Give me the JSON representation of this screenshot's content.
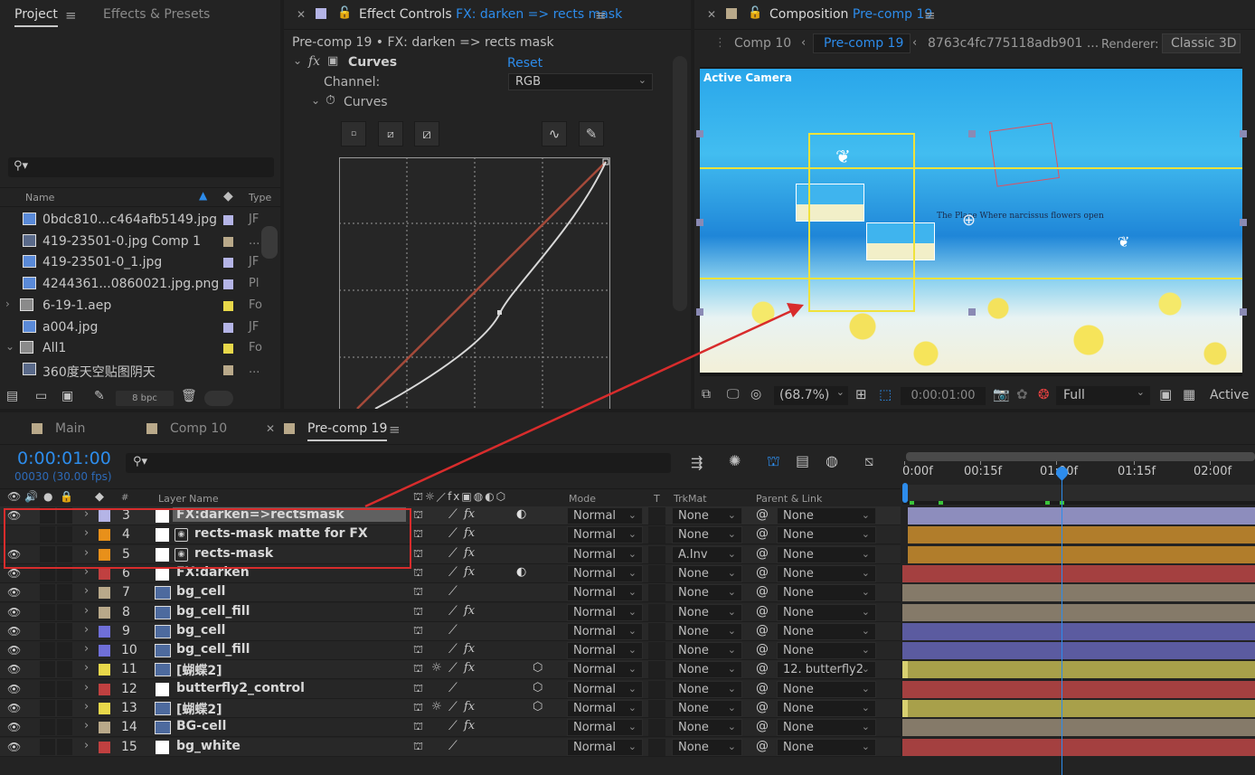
{
  "project": {
    "tabs": [
      "Project",
      "Effects & Presets"
    ],
    "search_placeholder": "",
    "col_name": "Name",
    "col_type": "Type",
    "items": [
      {
        "name": "0bdc810...c464afb5149.jpg",
        "type": "JF",
        "color": "#b4b4e6",
        "icon": "image-file-icon",
        "expand": ""
      },
      {
        "name": "419-23501-0.jpg Comp 1",
        "type": "...",
        "color": "#b9a98a",
        "icon": "composition-icon",
        "expand": ""
      },
      {
        "name": "419-23501-0_1.jpg",
        "type": "JF",
        "color": "#b4b4e6",
        "icon": "image-file-icon",
        "expand": ""
      },
      {
        "name": "4244361...0860021.jpg.png",
        "type": "Pl",
        "color": "#b4b4e6",
        "icon": "image-file-icon",
        "expand": ""
      },
      {
        "name": "6-19-1.aep",
        "type": "Fo",
        "color": "#e8d84a",
        "icon": "folder-icon",
        "expand": "›"
      },
      {
        "name": "a004.jpg",
        "type": "JF",
        "color": "#b4b4e6",
        "icon": "image-file-icon",
        "expand": ""
      },
      {
        "name": "All1",
        "type": "Fo",
        "color": "#e8d84a",
        "icon": "folder-icon",
        "expand": "⌄"
      },
      {
        "name": "360度天空贴图阴天",
        "type": "...",
        "color": "#b9a98a",
        "icon": "composition-icon",
        "expand": ""
      }
    ],
    "bpc": "8 bpc"
  },
  "effect_controls": {
    "tab_prefix": "Effect Controls",
    "tab_layer": "FX: darken => rects mask",
    "breadcrumb": "Pre-comp 19 • FX: darken => rects mask",
    "fx_label": "fx",
    "effect_name": "Curves",
    "reset": "Reset",
    "channel_label": "Channel:",
    "channel_value": "RGB",
    "curves_label": "Curves"
  },
  "composition": {
    "tab_prefix": "Composition",
    "tab_comp": "Pre-comp 19",
    "breadcrumbs": [
      "Comp 10",
      "Pre-comp 19",
      "8763c4fc775118adb901 ..."
    ],
    "renderer_label": "Renderer:",
    "renderer_value": "Classic 3D",
    "viewer_label": "Active Camera",
    "viewer_text": "The Place Where narcissus flowers open",
    "zoom": "(68.7%)",
    "timecode": "0:00:01:00",
    "resolution": "Full",
    "view": "Active"
  },
  "timeline": {
    "tabs": [
      {
        "label": "Main",
        "color": "#b9a98a"
      },
      {
        "label": "Comp 10",
        "color": "#b9a98a"
      },
      {
        "label": "Pre-comp 19",
        "color": "#b9a98a"
      }
    ],
    "timecode": "0:00:01:00",
    "frames": "00030 (30.00 fps)",
    "search_placeholder": "",
    "headers": {
      "num": "#",
      "layer_name": "Layer Name",
      "mode": "Mode",
      "t": "T",
      "trkmat": "TrkMat",
      "parent": "Parent & Link"
    },
    "ruler": [
      "0:00f",
      "00:15f",
      "01:00f",
      "01:15f",
      "02:00f"
    ],
    "layers": [
      {
        "num": "3",
        "name": "FX:darken=>rectsmask",
        "label_color": "#b4b4e6",
        "icon": "solid-icon",
        "eye": true,
        "fx": true,
        "adj": true,
        "threed": false,
        "shy": false,
        "mode": "Normal",
        "trkmat": "None",
        "parent": "None",
        "bar_color": "#8d8dbd",
        "selected": true
      },
      {
        "num": "4",
        "name": "rects-mask matte for FX",
        "label_color": "#e8901a",
        "icon": "precomp-icon",
        "eye": false,
        "fx": true,
        "adj": false,
        "threed": false,
        "shy": false,
        "mode": "Normal",
        "trkmat": "None",
        "parent": "None",
        "bar_color": "#b17d2b",
        "selected": false
      },
      {
        "num": "5",
        "name": "rects-mask",
        "label_color": "#e8901a",
        "icon": "precomp-icon",
        "eye": true,
        "fx": true,
        "adj": false,
        "threed": false,
        "shy": false,
        "mode": "Normal",
        "trkmat": "A.Inv",
        "parent": "None",
        "bar_color": "#b17d2b",
        "selected": false
      },
      {
        "num": "6",
        "name": "FX:darken",
        "label_color": "#c04040",
        "icon": "solid-icon",
        "eye": true,
        "fx": true,
        "adj": true,
        "threed": false,
        "shy": false,
        "mode": "Normal",
        "trkmat": "None",
        "parent": "None",
        "bar_color": "#a44040",
        "selected": false
      },
      {
        "num": "7",
        "name": "bg_cell",
        "label_color": "#b9a98a",
        "icon": "comp-layer-icon",
        "eye": true,
        "fx": false,
        "adj": false,
        "threed": false,
        "shy": false,
        "mode": "Normal",
        "trkmat": "None",
        "parent": "None",
        "bar_color": "#857a69",
        "selected": false
      },
      {
        "num": "8",
        "name": "bg_cell_fill",
        "label_color": "#b9a98a",
        "icon": "comp-layer-icon",
        "eye": true,
        "fx": true,
        "adj": false,
        "threed": false,
        "shy": false,
        "mode": "Normal",
        "trkmat": "None",
        "parent": "None",
        "bar_color": "#857a69",
        "selected": false
      },
      {
        "num": "9",
        "name": "bg_cell",
        "label_color": "#6f6fd8",
        "icon": "comp-layer-icon",
        "eye": true,
        "fx": false,
        "adj": false,
        "threed": false,
        "shy": false,
        "mode": "Normal",
        "trkmat": "None",
        "parent": "None",
        "bar_color": "#5b5ba0",
        "selected": false
      },
      {
        "num": "10",
        "name": "bg_cell_fill",
        "label_color": "#6f6fd8",
        "icon": "comp-layer-icon",
        "eye": true,
        "fx": true,
        "adj": false,
        "threed": false,
        "shy": false,
        "mode": "Normal",
        "trkmat": "None",
        "parent": "None",
        "bar_color": "#5b5ba0",
        "selected": false
      },
      {
        "num": "11",
        "name": "[蝴蝶2]",
        "label_color": "#e8d84a",
        "icon": "comp-layer-icon",
        "eye": true,
        "fx": true,
        "adj": false,
        "threed": true,
        "shy": true,
        "mode": "Normal",
        "trkmat": "None",
        "parent": "12. butterfly2",
        "bar_color": "#a8a04a",
        "selected": false
      },
      {
        "num": "12",
        "name": "butterfly2_control",
        "label_color": "#c04040",
        "icon": "solid-icon",
        "eye": true,
        "fx": false,
        "adj": false,
        "threed": true,
        "shy": false,
        "mode": "Normal",
        "trkmat": "None",
        "parent": "None",
        "bar_color": "#a44040",
        "selected": false
      },
      {
        "num": "13",
        "name": "[蝴蝶2]",
        "label_color": "#e8d84a",
        "icon": "comp-layer-icon",
        "eye": true,
        "fx": true,
        "adj": false,
        "threed": true,
        "shy": true,
        "mode": "Normal",
        "trkmat": "None",
        "parent": "None",
        "bar_color": "#a8a04a",
        "selected": false
      },
      {
        "num": "14",
        "name": "BG-cell",
        "label_color": "#b9a98a",
        "icon": "comp-layer-icon",
        "eye": true,
        "fx": true,
        "adj": false,
        "threed": false,
        "shy": false,
        "mode": "Normal",
        "trkmat": "None",
        "parent": "None",
        "bar_color": "#857a69",
        "selected": false
      },
      {
        "num": "15",
        "name": "bg_white",
        "label_color": "#c04040",
        "icon": "solid-icon",
        "eye": true,
        "fx": false,
        "adj": false,
        "threed": false,
        "shy": false,
        "mode": "Normal",
        "trkmat": "None",
        "parent": "None",
        "bar_color": "#a44040",
        "selected": false
      }
    ]
  },
  "colors": {
    "accent_blue": "#2d8ceb",
    "highlight_red": "#d82c2c",
    "selection_yellow": "#f0e23a"
  }
}
